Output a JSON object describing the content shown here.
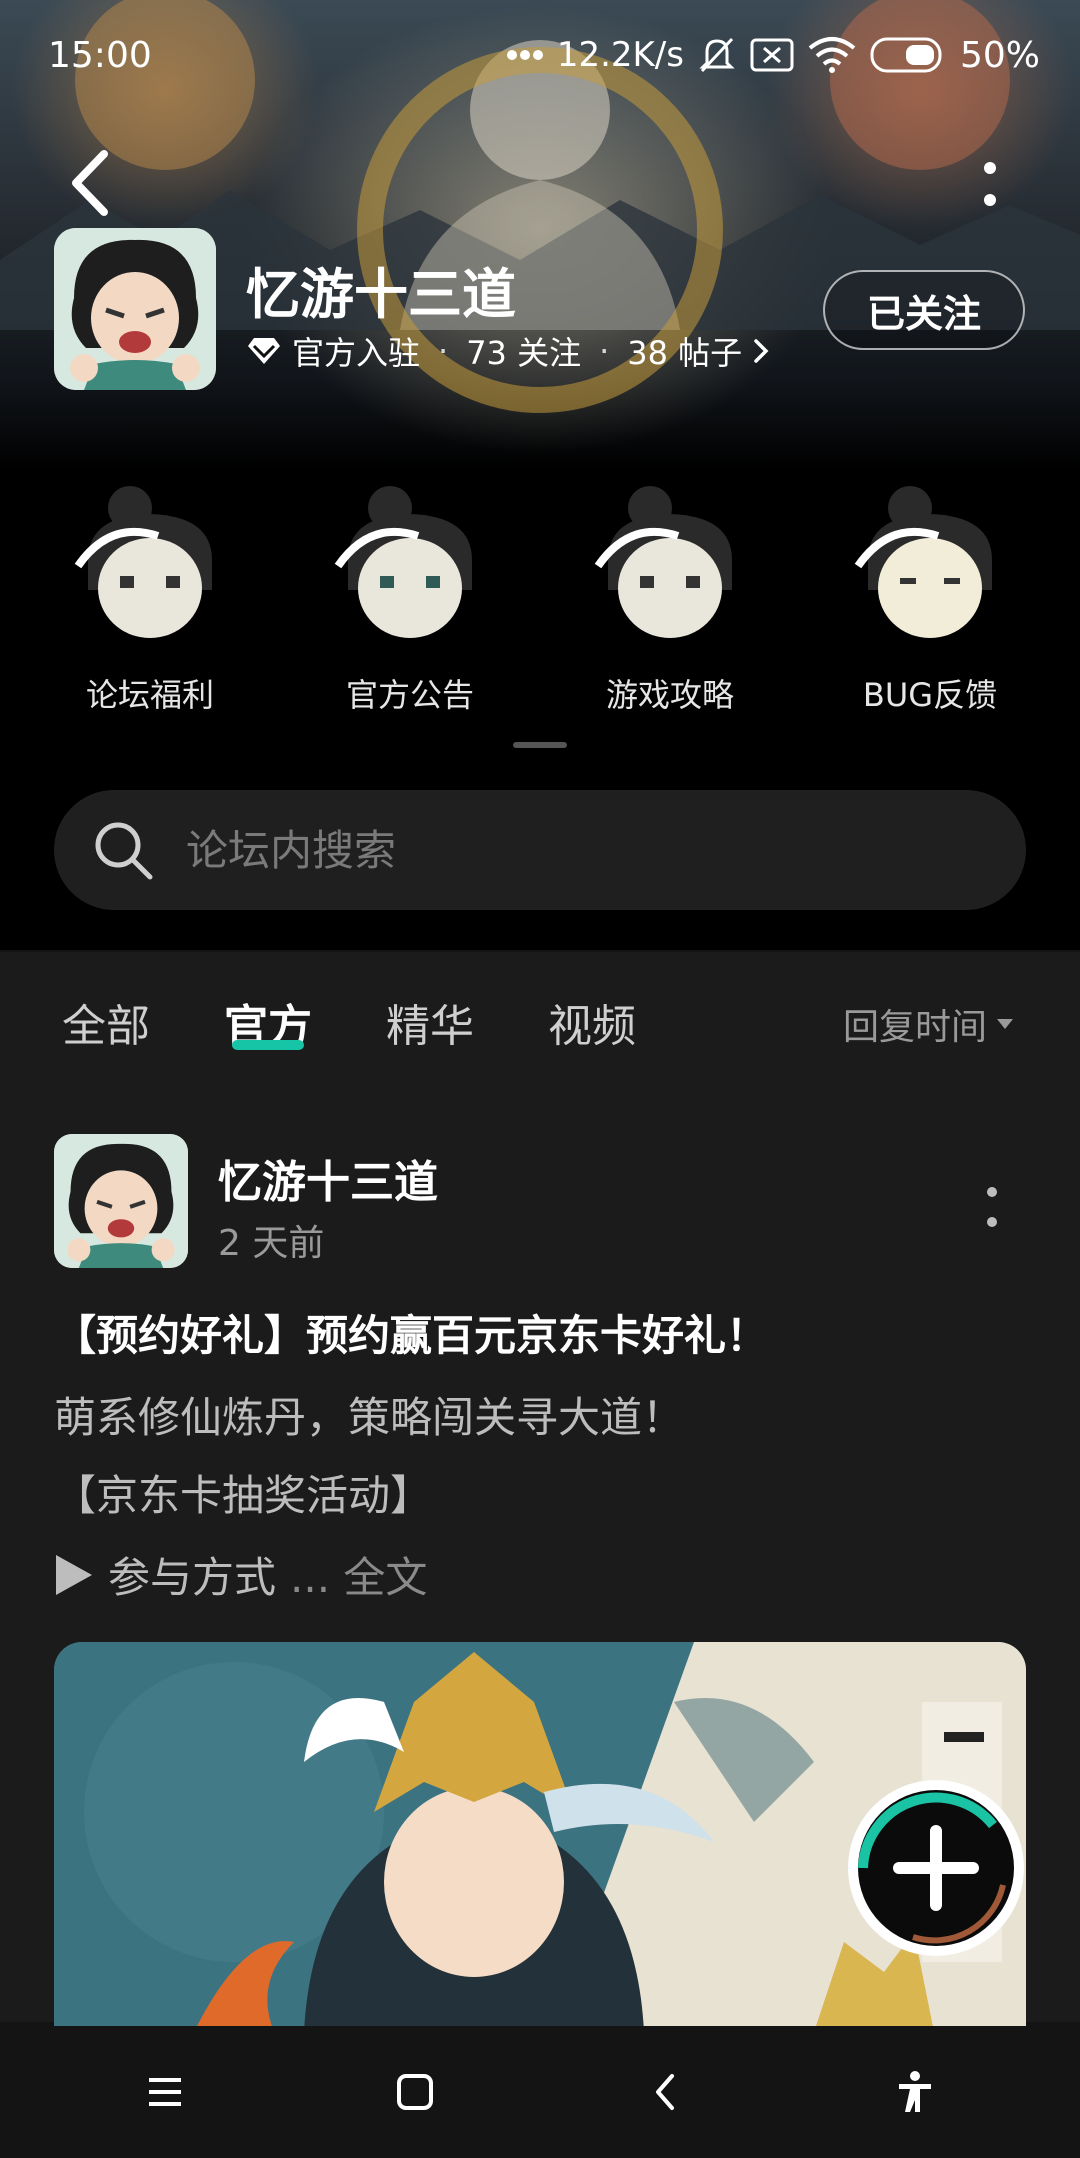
{
  "status_bar": {
    "time": "15:00",
    "net_speed": "12.2K/s",
    "battery": "50%"
  },
  "forum": {
    "title": "忆游十三道",
    "badge": "官方入驻",
    "followers": "73 关注",
    "posts": "38 帖子",
    "follow_label": "已关注"
  },
  "quick_entries": [
    {
      "label": "论坛福利"
    },
    {
      "label": "官方公告"
    },
    {
      "label": "游戏攻略"
    },
    {
      "label": "BUG反馈"
    }
  ],
  "search": {
    "placeholder": "论坛内搜索"
  },
  "tabs": [
    {
      "label": "全部",
      "active": false
    },
    {
      "label": "官方",
      "active": true
    },
    {
      "label": "精华",
      "active": false
    },
    {
      "label": "视频",
      "active": false
    }
  ],
  "sort": {
    "label": "回复时间"
  },
  "post": {
    "author": "忆游十三道",
    "time": "2 天前",
    "title": "【预约好礼】预约赢百元京东卡好礼！",
    "line1": "萌系修仙炼丹，策略闯关寻大道！",
    "line2": "【京东卡抽奖活动】",
    "line3": "参与方式",
    "more": "... 全文"
  },
  "colors": {
    "accent": "#15c5a6",
    "background": "#1b1b1b"
  }
}
